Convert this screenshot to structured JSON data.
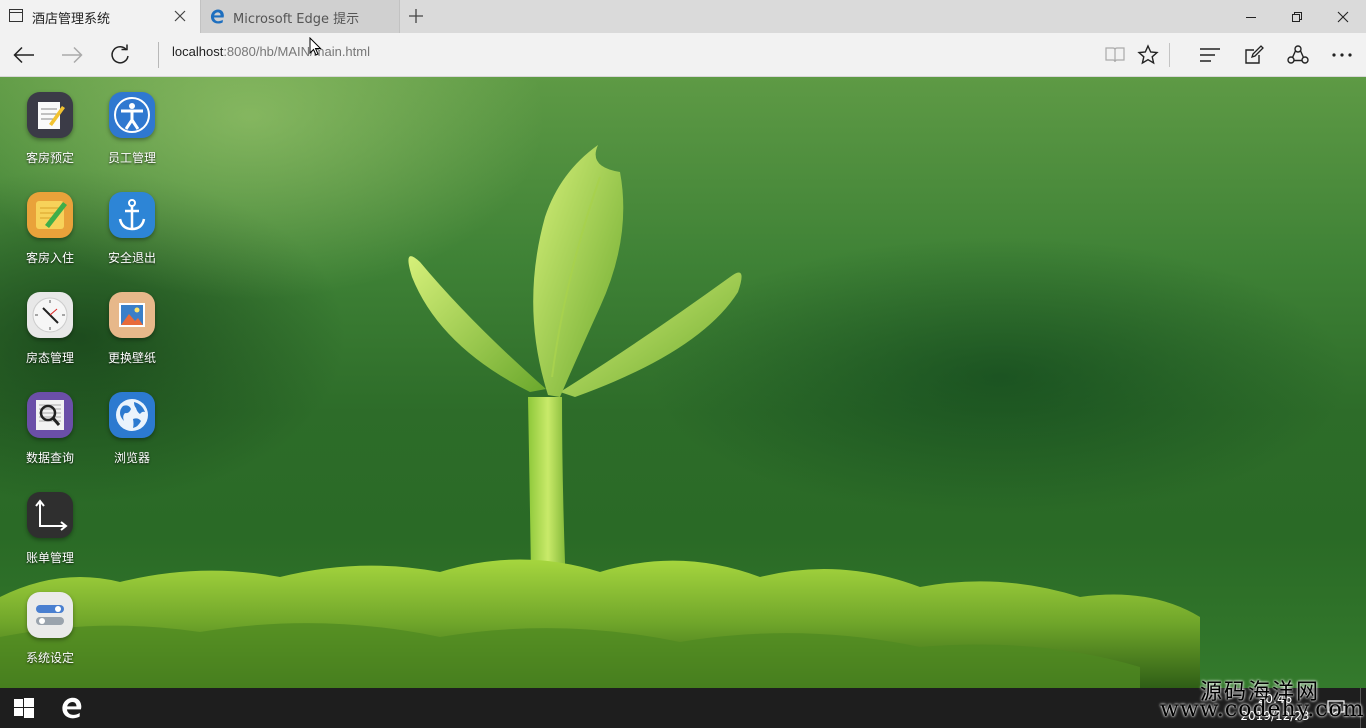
{
  "browser": {
    "tabs": [
      {
        "label": "酒店管理系统",
        "active": true
      },
      {
        "label": "Microsoft Edge 提示",
        "active": false
      }
    ],
    "url_host": "localhost",
    "url_rest": ":8080/hb/MAIN/main.html",
    "accent": "#1e6fbf"
  },
  "desktop": {
    "icons": [
      {
        "label": "客房预定",
        "icon": "notepad-icon"
      },
      {
        "label": "员工管理",
        "icon": "person-icon"
      },
      {
        "label": "客房入住",
        "icon": "pencil-note-icon"
      },
      {
        "label": "安全退出",
        "icon": "anchor-icon"
      },
      {
        "label": "房态管理",
        "icon": "clock-icon"
      },
      {
        "label": "更换壁纸",
        "icon": "picture-icon"
      },
      {
        "label": "数据查询",
        "icon": "magnifier-icon"
      },
      {
        "label": "浏览器",
        "icon": "globe-icon"
      },
      {
        "label": "账单管理",
        "icon": "axis-icon"
      },
      {
        "label": "系统设定",
        "icon": "toggle-settings-icon"
      }
    ]
  },
  "taskbar": {
    "time": "20:46",
    "date": "2019/12/23"
  },
  "watermark": {
    "line1": "源码海洋网",
    "line2": "www.codehy.com"
  }
}
